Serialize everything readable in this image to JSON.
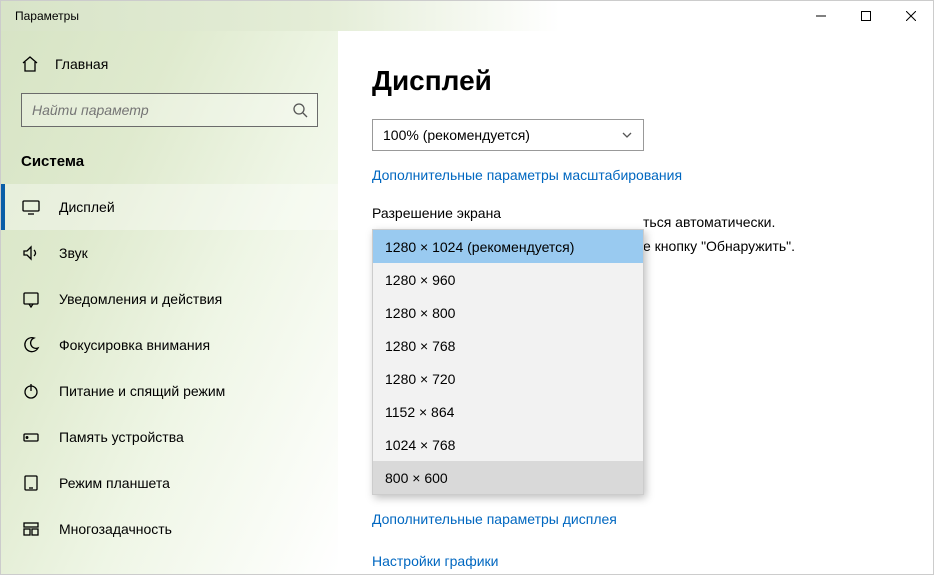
{
  "titlebar": {
    "title": "Параметры"
  },
  "sidebar": {
    "home": "Главная",
    "search_placeholder": "Найти параметр",
    "section": "Система",
    "items": [
      {
        "label": "Дисплей",
        "icon": "monitor-icon",
        "active": true
      },
      {
        "label": "Звук",
        "icon": "sound-icon"
      },
      {
        "label": "Уведомления и действия",
        "icon": "notification-icon"
      },
      {
        "label": "Фокусировка внимания",
        "icon": "moon-icon"
      },
      {
        "label": "Питание и спящий режим",
        "icon": "power-icon"
      },
      {
        "label": "Память устройства",
        "icon": "storage-icon"
      },
      {
        "label": "Режим планшета",
        "icon": "tablet-icon"
      },
      {
        "label": "Многозадачность",
        "icon": "multitask-icon"
      }
    ]
  },
  "main": {
    "title": "Дисплей",
    "scale_selected": "100% (рекомендуется)",
    "advanced_scaling": "Дополнительные параметры масштабирования",
    "resolution_label": "Разрешение экрана",
    "resolution_options": [
      "1280 × 1024 (рекомендуется)",
      "1280 × 960",
      "1280 × 800",
      "1280 × 768",
      "1280 × 720",
      "1152 × 864",
      "1024 × 768",
      "800 × 600"
    ],
    "behind1": "ться автоматически.",
    "behind2": "е кнопку \"Обнаружить\".",
    "advanced_display": "Дополнительные параметры дисплея",
    "graphics_settings": "Настройки графики"
  }
}
